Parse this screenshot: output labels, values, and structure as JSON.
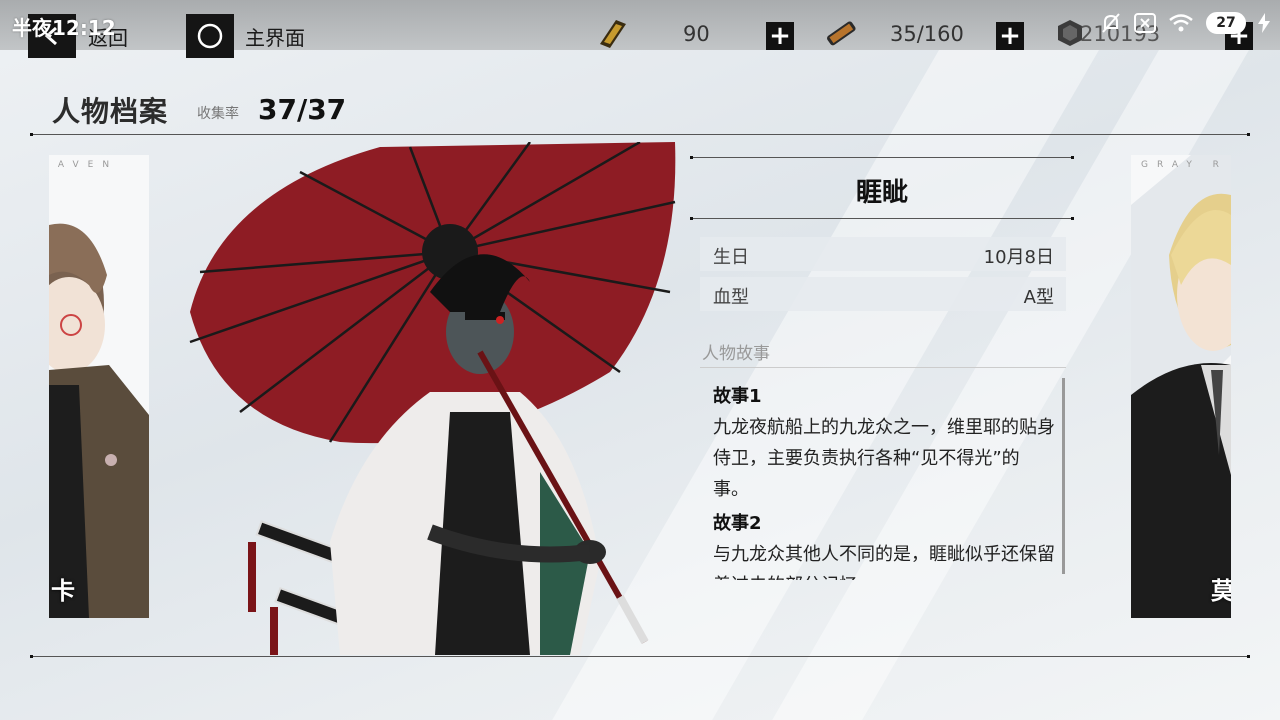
{
  "statusbar": {
    "time": "半夜12:12",
    "battery": "27"
  },
  "topbar": {
    "back_label": "返回",
    "home_label": "主界面",
    "resources": [
      {
        "icon": "gold-ticket-icon",
        "value": "90"
      },
      {
        "icon": "energy-tube-icon",
        "value": "35/160"
      },
      {
        "icon": "coin-icon",
        "value": "210193"
      }
    ]
  },
  "header": {
    "title": "人物档案",
    "collection_label": "收集率",
    "collection_value": "37/37"
  },
  "left_card": {
    "code": "RAVEN",
    "name": "卡"
  },
  "right_card": {
    "code": "GRAY R",
    "name": "莫"
  },
  "profile": {
    "name": "睚眦",
    "fields": [
      {
        "label": "生日",
        "value": "10月8日"
      },
      {
        "label": "血型",
        "value": "A型"
      }
    ],
    "story_section_label": "人物故事",
    "stories": [
      {
        "title": "故事1",
        "text": "九龙夜航船上的九龙众之一，维里耶的贴身侍卫，主要负责执行各种“见不得光”的事。"
      },
      {
        "title": "故事2",
        "text": "与九龙众其他人不同的是，睚眦似乎还保留着过去的部分记忆。"
      }
    ]
  },
  "colors": {
    "umbrella": "#8e1c24",
    "accent": "#111111"
  }
}
